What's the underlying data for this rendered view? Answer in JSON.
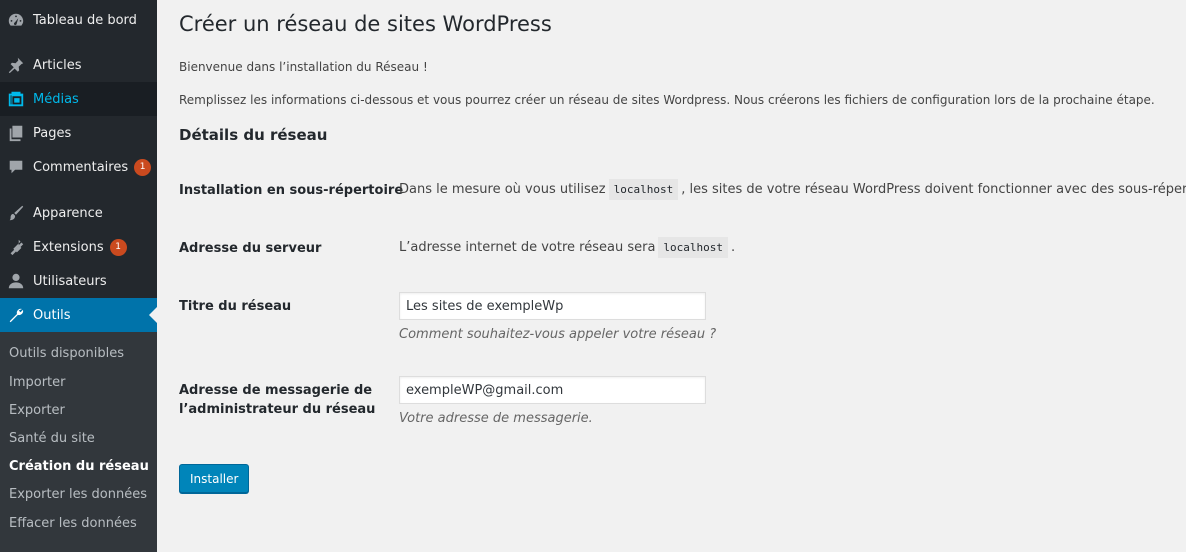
{
  "menu": {
    "items": [
      {
        "label": "Tableau de bord",
        "icon": "dashboard-icon"
      },
      {
        "label": "Articles",
        "icon": "pin-icon"
      },
      {
        "label": "Médias",
        "icon": "media-icon"
      },
      {
        "label": "Pages",
        "icon": "pages-icon"
      },
      {
        "label": "Commentaires",
        "icon": "comment-icon",
        "badge": "1"
      },
      {
        "label": "Apparence",
        "icon": "paintbrush-icon"
      },
      {
        "label": "Extensions",
        "icon": "plugin-icon",
        "badge": "1"
      },
      {
        "label": "Utilisateurs",
        "icon": "user-icon"
      },
      {
        "label": "Outils",
        "icon": "wrench-icon"
      }
    ],
    "submenu": [
      "Outils disponibles",
      "Importer",
      "Exporter",
      "Santé du site",
      "Création du réseau",
      "Exporter les données",
      "Effacer les données"
    ]
  },
  "page": {
    "title": "Créer un réseau de sites WordPress",
    "welcome": "Bienvenue dans l’installation du Réseau !",
    "intro": "Remplissez les informations ci-dessous et vous pourrez créer un réseau de sites Wordpress. Nous créerons les fichiers de configuration lors de la prochaine étape.",
    "section_title": "Détails du réseau"
  },
  "rows": {
    "subdir": {
      "label": "Installation en sous-répertoire",
      "text_before": "Dans le mesure où vous utilisez",
      "code": "localhost",
      "text_after": ", les sites de votre réseau WordPress doivent fonctionner avec des sous-répertoires. U"
    },
    "server": {
      "label": "Adresse du serveur",
      "text_before": "L’adresse internet de votre réseau sera",
      "code": "localhost",
      "text_after": "."
    },
    "title": {
      "label": "Titre du réseau",
      "value": "Les sites de exempleWp",
      "description": "Comment souhaitez-vous appeler votre réseau ?"
    },
    "email": {
      "label_line1": "Adresse de messagerie de",
      "label_line2": "l’administrateur du réseau",
      "value": "exempleWP@gmail.com",
      "description": "Votre adresse de messagerie."
    }
  },
  "submit_label": "Installer",
  "colors": {
    "sidebar": "#23282d",
    "submenu": "#32373c",
    "current": "#0073aa",
    "hover_text": "#00b9eb",
    "badge": "#ca4a1f",
    "primary_button": "#0085ba"
  }
}
